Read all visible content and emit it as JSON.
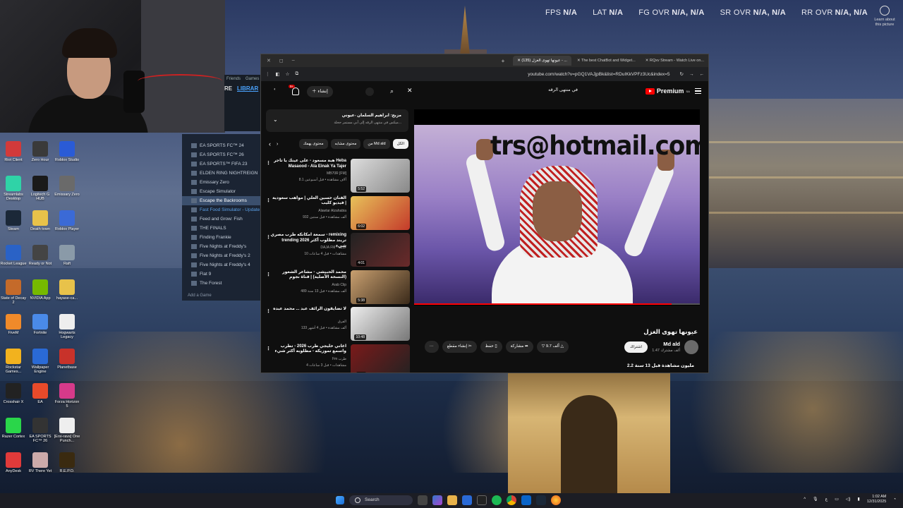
{
  "hud": [
    {
      "label": "FPS",
      "value": "N/A"
    },
    {
      "label": "LAT",
      "value": "N/A"
    },
    {
      "label": "FG OVR",
      "value": "N/A, N/A"
    },
    {
      "label": "SR OVR",
      "value": "N/A, N/A"
    },
    {
      "label": "RR OVR",
      "value": "N/A, N/A"
    }
  ],
  "learn_about": "Learn about this picture",
  "steam": {
    "top": {
      "friends": "Friends",
      "games": "Games",
      "re": "RE",
      "library": "LIBRAR"
    },
    "games": [
      {
        "name": "EA SPORTS FC™ 24"
      },
      {
        "name": "EA SPORTS FC™ 26"
      },
      {
        "name": "EA SPORTS™ FIFA 23"
      },
      {
        "name": "ELDEN RING NIGHTREIGN"
      },
      {
        "name": "Emissary Zero"
      },
      {
        "name": "Escape Simulator"
      },
      {
        "name": "Escape the Backrooms",
        "selected": true
      },
      {
        "name": "Fast Food Simulator - Update",
        "update": true
      },
      {
        "name": "Feed and Grow: Fish"
      },
      {
        "name": "THE FINALS"
      },
      {
        "name": "Finding Frankie"
      },
      {
        "name": "Five Nights at Freddy's"
      },
      {
        "name": "Five Nights at Freddy's 2"
      },
      {
        "name": "Five Nights at Freddy's 4"
      },
      {
        "name": "Flat 9"
      },
      {
        "name": "The Forest"
      }
    ],
    "add_game": "Add a Game"
  },
  "desktop_icons": [
    {
      "label": "Riot Client",
      "color": "#d23a3a"
    },
    {
      "label": "Zero Hour",
      "color": "#3a3a3a"
    },
    {
      "label": "Roblox Studio",
      "color": "#2a5bd6"
    },
    {
      "label": "Streamlabs Desktop",
      "color": "#2fd3a7"
    },
    {
      "label": "Logitech G HUB",
      "color": "#1a1a1a"
    },
    {
      "label": "Emissary Zero",
      "color": "#6a6a6a"
    },
    {
      "label": "Steam",
      "color": "#1b2838"
    },
    {
      "label": "Death town",
      "color": "#e8c24a"
    },
    {
      "label": "Roblox Player",
      "color": "#3b6ad6"
    },
    {
      "label": "Rocket League",
      "color": "#2a62c6"
    },
    {
      "label": "Ready or Not",
      "color": "#444"
    },
    {
      "label": "Raft",
      "color": "#8a9aa8"
    },
    {
      "label": "State of Decay 2",
      "color": "#c46a2a"
    },
    {
      "label": "NVIDIA App",
      "color": "#76b900"
    },
    {
      "label": "hayase-ca...",
      "color": "#e8c24a"
    },
    {
      "label": "FiveM",
      "color": "#f08a2a"
    },
    {
      "label": "Fortnite",
      "color": "#4a8ae8"
    },
    {
      "label": "Hogwarts Legacy",
      "color": "#eee"
    },
    {
      "label": "Rockstar Games...",
      "color": "#f2b21e"
    },
    {
      "label": "Wallpaper Engine",
      "color": "#2a6ad6"
    },
    {
      "label": "Planetbase",
      "color": "#c8322a"
    },
    {
      "label": "Crosshair X",
      "color": "#222"
    },
    {
      "label": "EA",
      "color": "#e84a2a"
    },
    {
      "label": "Forza Horizon 5",
      "color": "#d63a8a"
    },
    {
      "label": "Razer Cortex",
      "color": "#2ad64a"
    },
    {
      "label": "EA SPORTS FC™ 26",
      "color": "#333"
    },
    {
      "label": "[Ersi-ravs] One Punch...",
      "color": "#eee"
    },
    {
      "label": "AnyDesk",
      "color": "#e03a3a"
    },
    {
      "label": "RV There Yet",
      "color": "#caa"
    },
    {
      "label": "R.E.P.O.",
      "color": "#3a2a10"
    }
  ],
  "browser": {
    "tabs": [
      {
        "title": "(135) عيونها تهوى الغزل - ...",
        "active": true
      },
      {
        "title": "The best ChatBot and Widget..."
      },
      {
        "title": "RQxv Stream - Watch Live on..."
      }
    ],
    "url": "youtube.com/watch?v=pGQ1VAJjpBk&list=RDuIKkVPFz3Uc&index=5",
    "youtube": {
      "premium": "Premium",
      "premium_region": "SA",
      "search_query": "في منتهى الرقه",
      "create": "إنشاء",
      "notifications": "9+",
      "video_overlay_text": "trs@hotmail.com",
      "video_title": "عيونها تهوى الغزل",
      "channel": "Md ald",
      "subscribers": "1.47 ألف مشترك",
      "subscribe": "اشتراك",
      "likes": "9.7 ألف",
      "share": "مشاركة",
      "save": "حفظ",
      "clip": "إنشاء مقطع",
      "views": "2.2 مليون مشاهدة قبل 13 سنة",
      "playlist_title": "مزيج: ابراهيم السلمان -عيوني",
      "playlist_sub": "ميكس في منتهى الرقه إلى آبي مستمر ححلة...",
      "chips": [
        "الكل",
        "من Md ald",
        "محتوى مشابه",
        "محتوى يهمك"
      ],
      "related": [
        {
          "title": "هبة مسعود - على عينك يا تاجر Heba Masaood - Ala Einak Ya Tajer",
          "channel": "MB70R [FM]",
          "meta": "8.1 آلاف مشاهدة • قبل أسبوعين",
          "duration": "5:52"
        },
        {
          "title": "الفنان حسين العلي | مواهب سعودية | فيديو كليب",
          "channel": "Alawtar Alzahabia",
          "meta": "932 ألف مشاهدة • قبل سنتين",
          "duration": "6:02"
        },
        {
          "title": "سمعة امكانكه طرب مصري - remixing trending 2026 تريند مطلوب أكثر شيء",
          "channel": "DAJA FM - خدمة",
          "meta": "10 مشاهدات • قبل 4 ساعات",
          "duration": "4:01"
        },
        {
          "title": "محمد الحبيشي - مشاعر الشعور (النسخة الأصلية) | قناة نجوم",
          "channel": "Arab Clip",
          "meta": "489 ألف مشاهدة • قبل 13 سنة",
          "duration": "5:38"
        },
        {
          "title": "لا تضايقون الرائف عبد ... محمد عبده",
          "channel": "الفرق",
          "meta": "133 ألف مشاهدة • قبل 4 أشهر",
          "duration": "10:48"
        },
        {
          "title": "اغاني خليجي طرب 2026 - تطرب واسمع تموزيكه - مطلوبه أكثر شيء",
          "channel": "Fm طرب",
          "meta": "4 مشاهدات • قبل 3 ساعات",
          "duration": "3:55"
        }
      ]
    }
  },
  "taskbar": {
    "search": "Search",
    "time": "1:02 AM",
    "date": "12/31/2025",
    "lang": "ع"
  }
}
